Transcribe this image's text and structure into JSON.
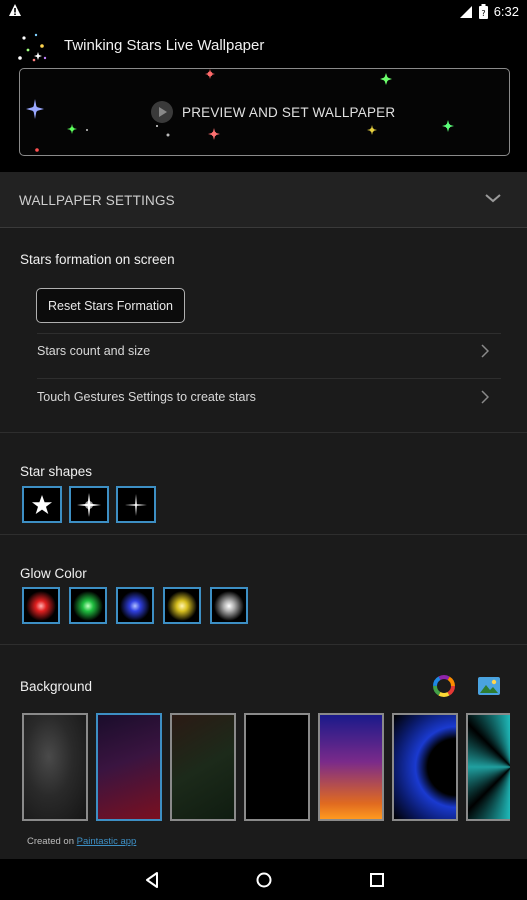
{
  "status_bar": {
    "time": "6:32"
  },
  "app": {
    "title": "Twinking Stars Live Wallpaper"
  },
  "preview": {
    "label": "PREVIEW AND SET WALLPAPER"
  },
  "settings_section": {
    "title": "WALLPAPER SETTINGS"
  },
  "stars_formation": {
    "title": "Stars formation on screen",
    "reset_label": "Reset Stars Formation",
    "items": [
      {
        "label": "Stars count and size"
      },
      {
        "label": "Touch Gestures Settings to create stars"
      }
    ]
  },
  "star_shapes": {
    "title": "Star shapes",
    "shapes": [
      "five-point-star-icon",
      "four-point-glow-star-icon",
      "four-point-thin-star-icon"
    ]
  },
  "glow_color": {
    "title": "Glow Color",
    "colors": [
      "#e02020",
      "#20c040",
      "#3040e0",
      "#d8c020",
      "#b0b0b0"
    ]
  },
  "background": {
    "title": "Background",
    "tools": [
      "color-wheel-icon",
      "image-gallery-icon"
    ],
    "credit_prefix": "Created on",
    "credit_link": "Paintastic app"
  },
  "colors": {
    "accent": "#3d8fc4"
  }
}
